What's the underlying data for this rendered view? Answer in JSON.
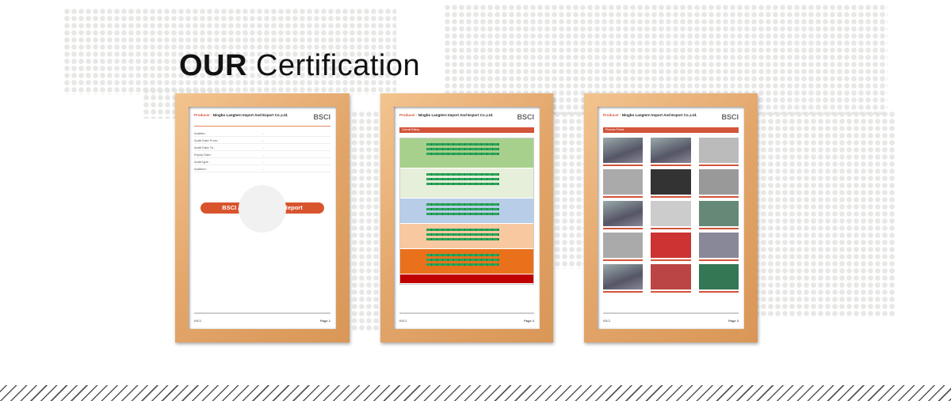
{
  "heading": {
    "bold": "OUR",
    "rest": " Certification"
  },
  "documents": [
    {
      "producer_label": "Producer :",
      "producer": "Ningbo Langtern Import And Export Co.,Ltd.",
      "logo": "BSCI",
      "report_title": "BSCI Audit Summary Report",
      "page": "Page 1"
    },
    {
      "producer_label": "Producer :",
      "producer": "Ningbo Langtern Import And Export Co.,Ltd.",
      "logo": "BSCI",
      "section": "Overall Rating",
      "page": "Page 2"
    },
    {
      "producer_label": "Producer :",
      "producer": "Ningbo Langtern Import And Export Co.,Ltd.",
      "logo": "BSCI",
      "section": "Pictures Points",
      "page": "Page 3"
    }
  ],
  "colors": {
    "accent": "#d8542d",
    "frame": "#e2a56a"
  }
}
